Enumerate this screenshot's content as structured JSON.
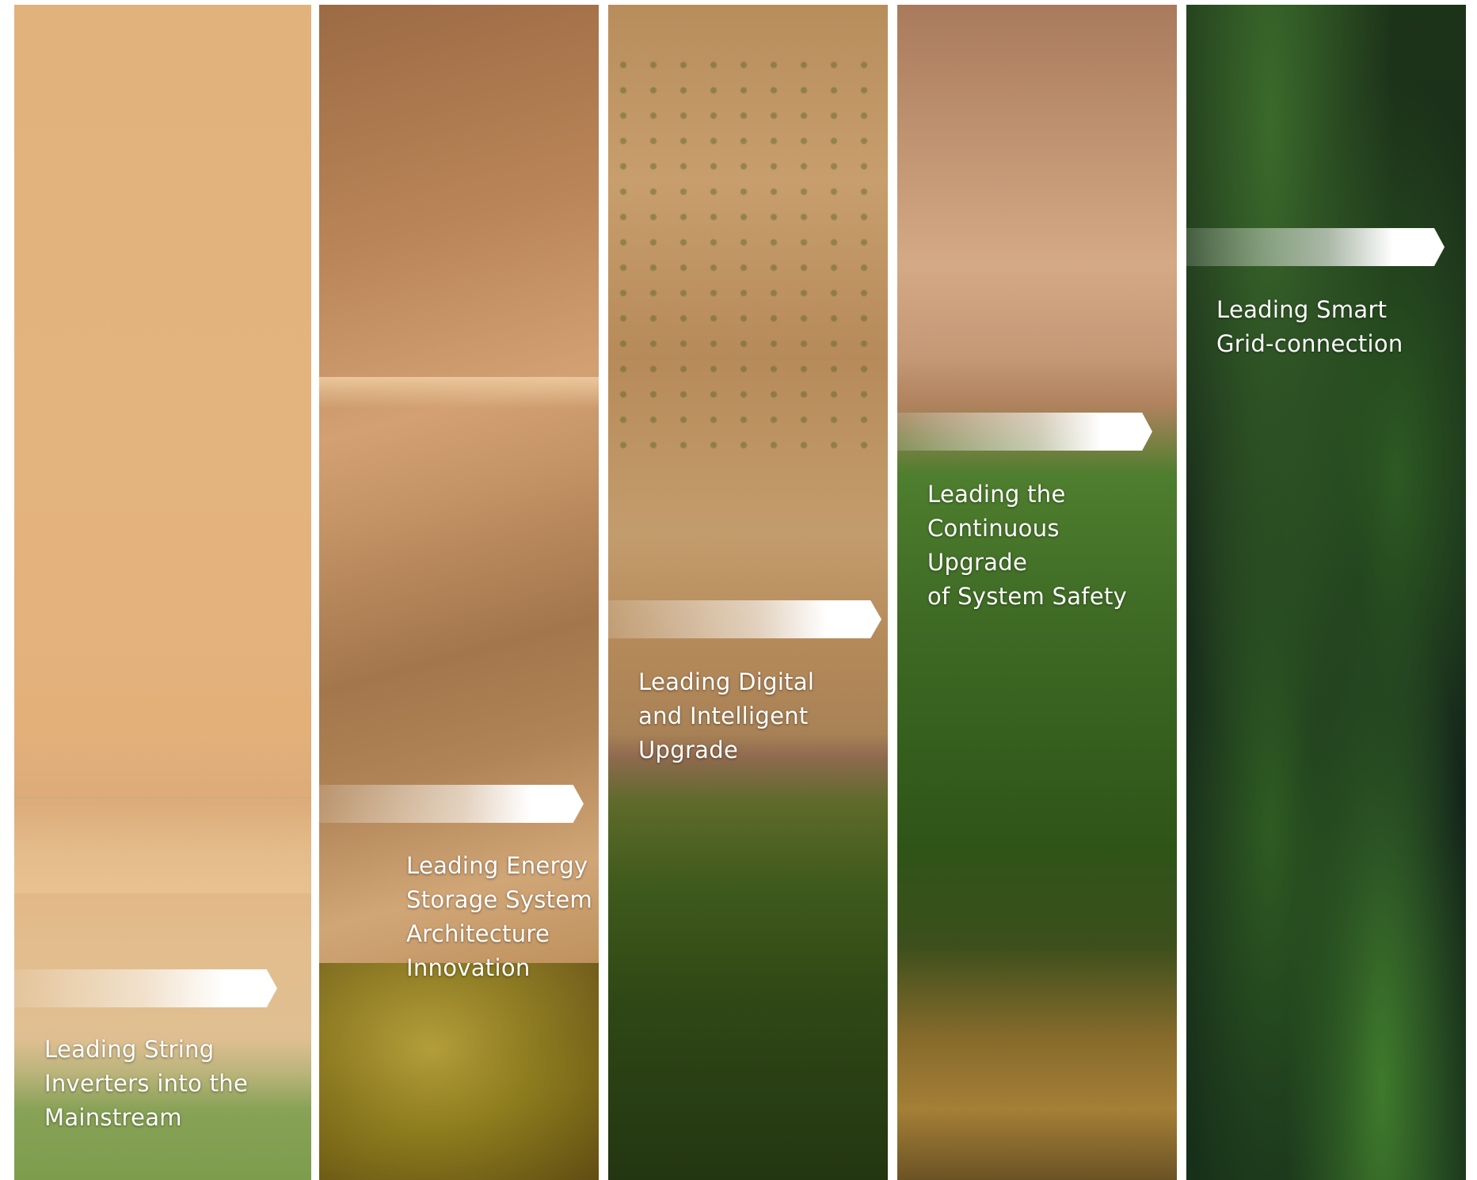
{
  "panels": [
    {
      "id": "string-inverters",
      "lines": [
        "Leading String",
        "Inverters into the",
        "Mainstream"
      ]
    },
    {
      "id": "energy-storage",
      "lines": [
        "Leading Energy",
        "Storage System",
        "Architecture",
        "Innovation"
      ]
    },
    {
      "id": "digital-intelligent",
      "lines": [
        "Leading Digital",
        "and Intelligent",
        "Upgrade"
      ]
    },
    {
      "id": "system-safety",
      "lines": [
        "Leading the",
        "Continuous Upgrade",
        "of System Safety"
      ]
    },
    {
      "id": "smart-grid",
      "lines": [
        "Leading Smart",
        "Grid-connection"
      ]
    }
  ],
  "colors": {
    "background": "#ffffff",
    "label_text": "#ffffff",
    "arrow_fill": "#ffffff"
  },
  "icons": [
    "arrow-banner-icon"
  ]
}
